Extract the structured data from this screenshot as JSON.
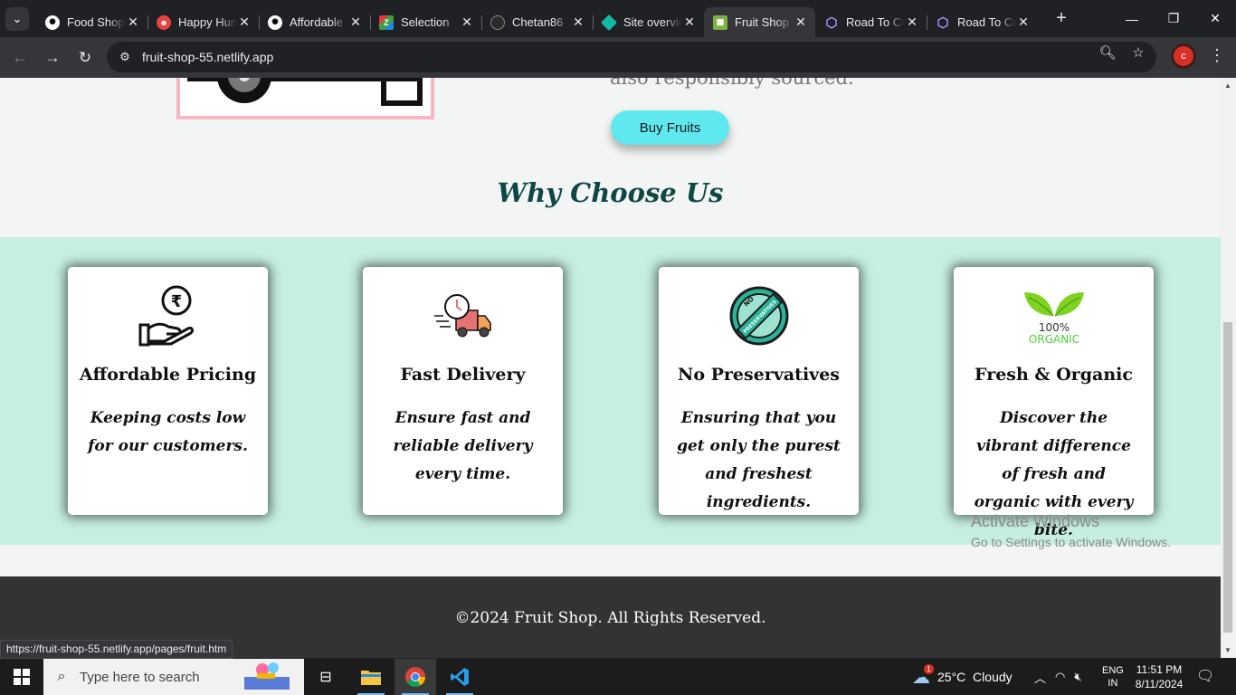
{
  "browser": {
    "tabs": [
      {
        "title": "Food Shop",
        "icon": "openai-icon",
        "color": "#ffffff"
      },
      {
        "title": "Happy Hungry",
        "icon": "smiley-icon",
        "color": "#e8413e"
      },
      {
        "title": "Affordable",
        "icon": "openai-icon",
        "color": "#ffffff"
      },
      {
        "title": "Selection",
        "icon": "zoho-icon",
        "color": "#f4b400"
      },
      {
        "title": "Chetan86",
        "icon": "github-icon",
        "color": "#2b2b2b"
      },
      {
        "title": "Site overview",
        "icon": "netlify-icon",
        "color": "#14b8a6"
      },
      {
        "title": "Fruit Shop",
        "icon": "fruit-icon",
        "color": "#7cb342"
      },
      {
        "title": "Road To Code",
        "icon": "hexagon-icon",
        "color": "#7c4dff"
      },
      {
        "title": "Road To Code",
        "icon": "hexagon-icon",
        "color": "#7c4dff"
      }
    ],
    "active_tab_index": 6,
    "url": "fruit-shop-55.netlify.app",
    "profile_initial": "c",
    "status_url": "https://fruit-shop-55.netlify.app/pages/fruit.htm"
  },
  "page": {
    "about_tail": "also responsibly sourced.",
    "buy_button": "Buy Fruits",
    "why_title": "Why Choose Us",
    "features": [
      {
        "title": "Affordable Pricing",
        "text": "Keeping costs low for our customers.",
        "icon": "rupee-hand-icon"
      },
      {
        "title": "Fast Delivery",
        "text": "Ensure fast and reliable delivery every time.",
        "icon": "delivery-truck-icon"
      },
      {
        "title": "No Preservatives",
        "text": "Ensuring that you get only the purest and freshest ingredients.",
        "icon": "no-preservatives-badge-icon"
      },
      {
        "title": "Fresh & Organic",
        "text": "Discover the vibrant difference of fresh and organic with every bite.",
        "icon": "organic-leaf-icon"
      }
    ],
    "organic_badge": {
      "line1": "100%",
      "line2": "ORGANIC"
    },
    "no_pres_badge": {
      "line1": "NO",
      "line2": "PRESERVATIVES"
    },
    "footer": "©2024 Fruit Shop. All Rights Reserved."
  },
  "watermark": {
    "line1": "Activate Windows",
    "line2": "Go to Settings to activate Windows."
  },
  "taskbar": {
    "search_placeholder": "Type here to search",
    "weather": "25°C  Cloudy",
    "weather_badge": "1",
    "lang1": "ENG",
    "lang2": "IN",
    "time": "11:51 PM",
    "date": "8/11/2024"
  },
  "colors": {
    "accent_button": "#5fe9ef",
    "features_bg": "#c6efe1",
    "title_color": "#0e4746",
    "footer_bg": "#333333"
  }
}
